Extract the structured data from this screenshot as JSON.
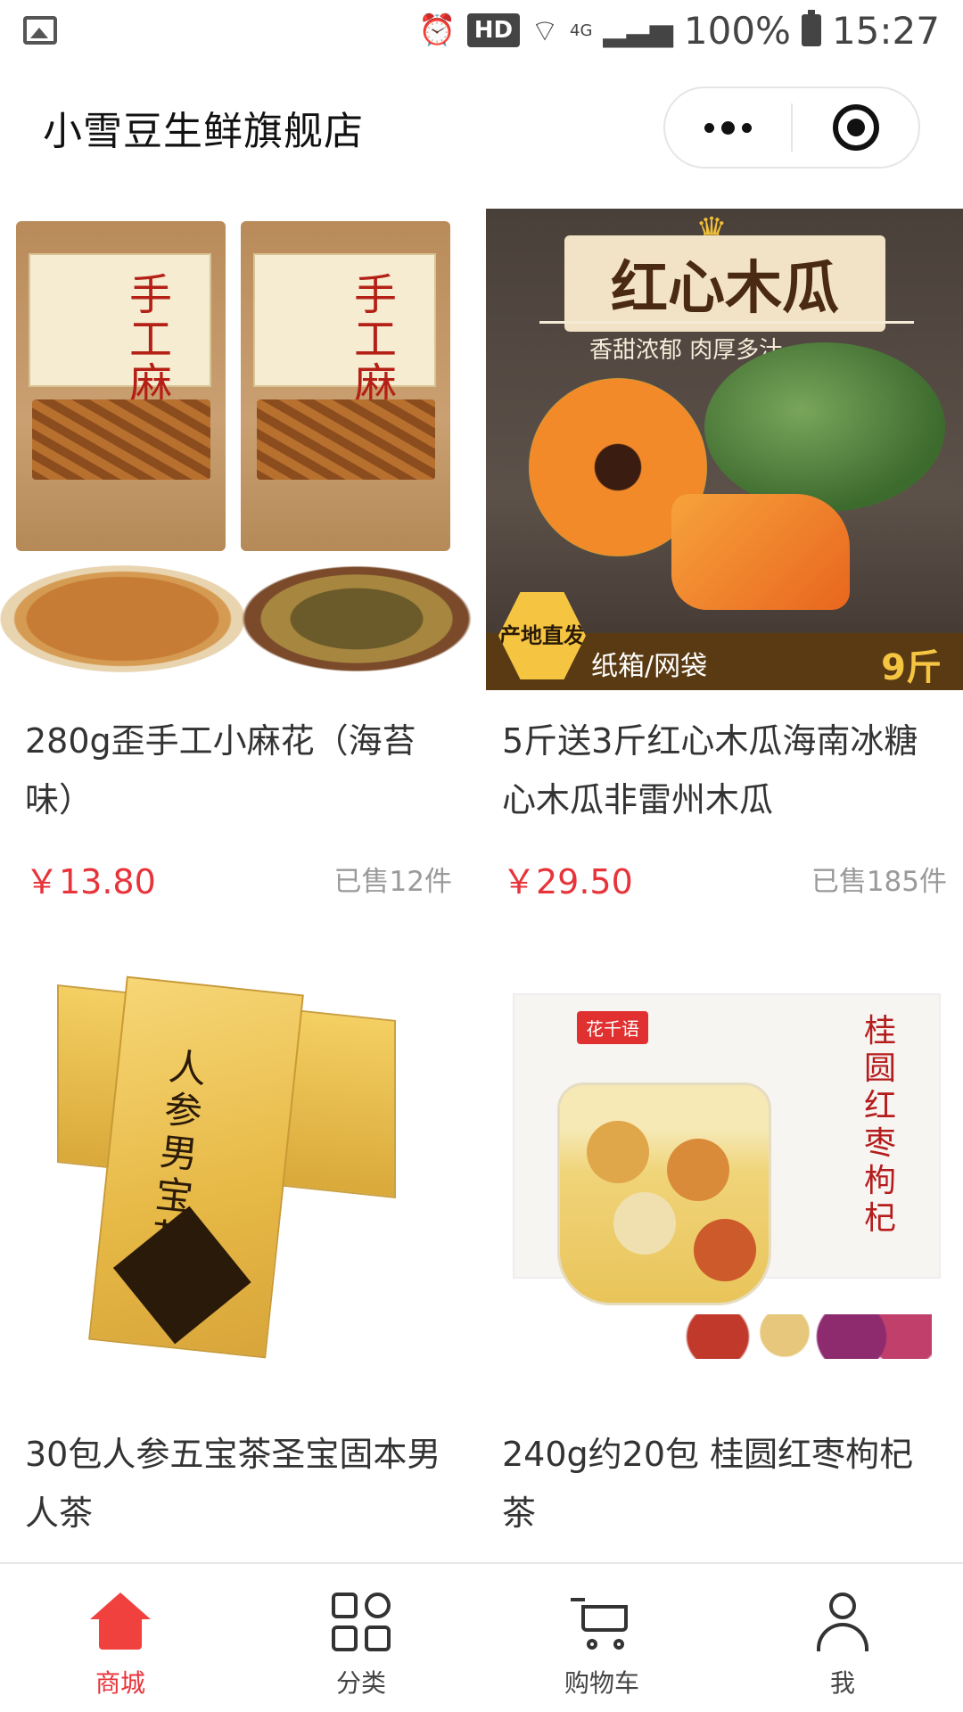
{
  "status_bar": {
    "badge": "HD",
    "network": "4G",
    "battery": "100%",
    "time": "15:27"
  },
  "header": {
    "title": "小雪豆生鲜旗舰店"
  },
  "products": [
    {
      "name": "280g歪手工小麻花（海苔味）",
      "price": "￥13.80",
      "sold": "已售12件",
      "image_text": "手工麻花"
    },
    {
      "name": "5斤送3斤红心木瓜海南冰糖心木瓜非雷州木瓜",
      "price": "￥29.50",
      "sold": "已售185件",
      "image_title": "红心木瓜",
      "image_subtitle": "香甜浓郁 肉厚多汁",
      "image_badge": "产地直发",
      "image_pack": "纸箱/网袋",
      "image_weight": "9斤"
    },
    {
      "name": "30包人参五宝茶圣宝固本男人茶",
      "image_text": "人参男宝茶"
    },
    {
      "name": "240g约20包 桂圆红枣枸杞茶",
      "image_brand": "花千语",
      "image_text": "桂圆红枣枸杞"
    }
  ],
  "tabbar": {
    "items": [
      {
        "label": "商城",
        "icon": "home-icon",
        "active": true
      },
      {
        "label": "分类",
        "icon": "grid-icon",
        "active": false
      },
      {
        "label": "购物车",
        "icon": "cart-icon",
        "active": false
      },
      {
        "label": "我",
        "icon": "user-icon",
        "active": false
      }
    ]
  },
  "colors": {
    "accent": "#e8333a",
    "sold_text": "#9a9a9a"
  }
}
